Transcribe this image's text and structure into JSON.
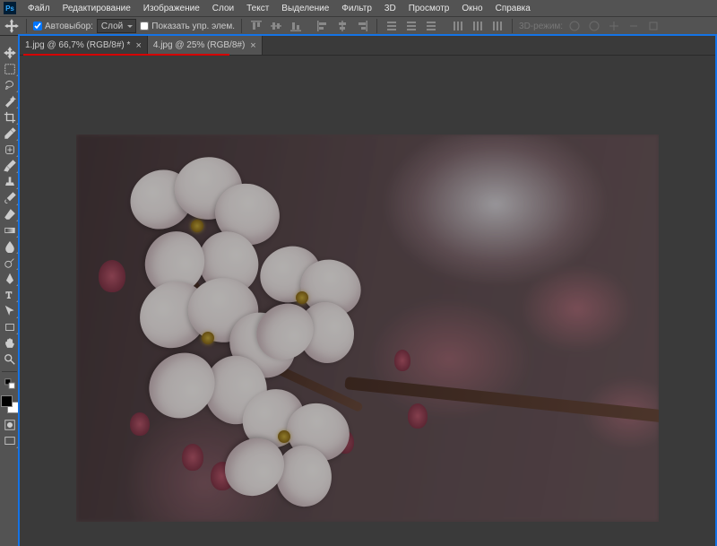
{
  "app": {
    "icon_text": "Ps"
  },
  "menu": {
    "items": [
      "Файл",
      "Редактирование",
      "Изображение",
      "Слои",
      "Текст",
      "Выделение",
      "Фильтр",
      "3D",
      "Просмотр",
      "Окно",
      "Справка"
    ]
  },
  "options": {
    "autoselect_label": "Автовыбор:",
    "target_dd": "Слой",
    "show_controls_label": "Показать упр. элем.",
    "mode_label": "3D-режим:"
  },
  "tabs": [
    {
      "label": "1.jpg @ 66,7% (RGB/8#) *",
      "active": false
    },
    {
      "label": "4.jpg @ 25% (RGB/8#)",
      "active": true
    }
  ],
  "tools": [
    "move",
    "marquee",
    "lasso",
    "magic-wand",
    "crop",
    "eyedropper",
    "healing",
    "brush",
    "clone",
    "history-brush",
    "eraser",
    "gradient",
    "blur",
    "dodge",
    "pen",
    "type",
    "path-select",
    "rectangle",
    "hand",
    "zoom"
  ],
  "colors": {
    "fg": "#000000",
    "bg": "#ffffff"
  },
  "extra_tools": [
    "quick-mask",
    "screen-mode"
  ],
  "canvas": {
    "subject": "cherry-blossom-photo"
  }
}
